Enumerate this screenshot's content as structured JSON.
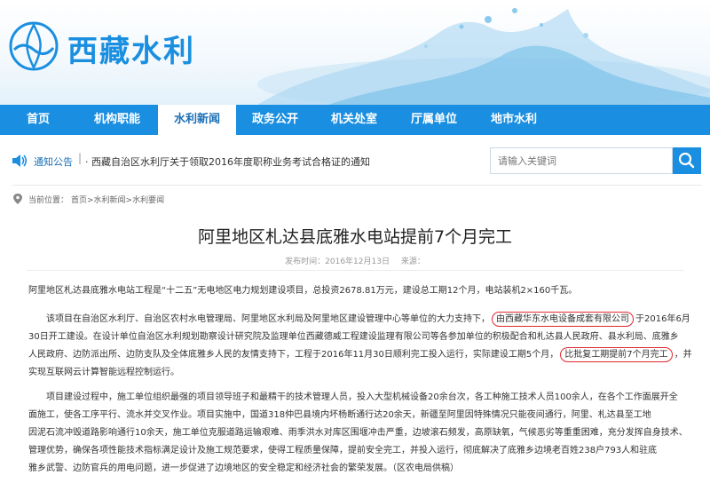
{
  "site": {
    "title": "西藏水利",
    "brand_color": "#1a8ee0"
  },
  "nav": {
    "items": [
      "首页",
      "机构职能",
      "水利新闻",
      "政务公开",
      "机关处室",
      "厅属单位",
      "地市水利"
    ],
    "active_index": 2
  },
  "notice": {
    "label": "通知公告",
    "text": "· 西藏自治区水利厅关于领取2016年度职称业务考试合格证的通知"
  },
  "search": {
    "placeholder": "请输入关键词",
    "icon": "search-icon"
  },
  "breadcrumb": {
    "label": "当前位置：",
    "path": "首页>水利新闻>水利要闻"
  },
  "article": {
    "title": "阿里地区札达县底雅水电站提前7个月完工",
    "published": "发布时间：2016年12月13日",
    "source": "来源：",
    "p1": "阿里地区札达县底雅水电站工程是“十二五”无电地区电力规划建设项目，总投资2678.81万元，建设总工期12个月，电站装机2×160千瓦。",
    "p2_l1a": "该项目在自治区水利厅、自治区农村水电管理局、阿里地区水利局及阿里地区建设管理中心等单位的大力支持下，",
    "p2_l1_hl": "由西藏华东水电设备成套有限公司",
    "p2_l1b": "于2016年6月",
    "p2_l2": "30日开工建设。在设计单位自治区水利规划勘察设计研究院及监理单位西藏德威工程建设监理有限公司等各参加单位的积极配合和札达县人民政府、县水利局、底雅乡",
    "p2_l3a": "人民政府、边防派出所、边防支队及全体底雅乡人民的友情支持下，工程于2016年11月30日顺利完工投入运行，实际建设工期5个月，",
    "p2_l3_hl": "比批复工期提前7个月完工",
    "p2_l3b": "，并",
    "p2_l4": "实现互联网云计算智能远程控制运行。",
    "p3_l1": "项目建设过程中，施工单位组织最强的项目领导班子和最精干的技术管理人员，投入大型机械设备20余台次，各工种施工技术人员100余人，在各个工作面展开全",
    "p3_l2": "面施工，使各工序平行、流水并交叉作业。项目实施中，国道318仲巴县境内坏杨断通行达20余天，新疆至阿里因特殊情况只能夜间通行，阿里、札达县至工地",
    "p3_l3": "因泥石流冲毁道路影响通行10余天，施工单位克服道路运输艰难、雨季洪水对库区围堰冲击严重，边坡滚石频发，高原缺氧，气候恶劣等重重困难，充分发挥自身技术、",
    "p3_l4": "管理优势，确保各项性能技术指标满足设计及施工规范要求，使得工程质量保障，提前安全完工，并投入运行，彻底解决了底雅乡边境老百姓238户793人和驻底",
    "p3_l5": "雅乡武警、边防官兵的用电问题，进一步促进了边境地区的安全稳定和经济社会的繁荣发展。（区农电局供稿）"
  }
}
